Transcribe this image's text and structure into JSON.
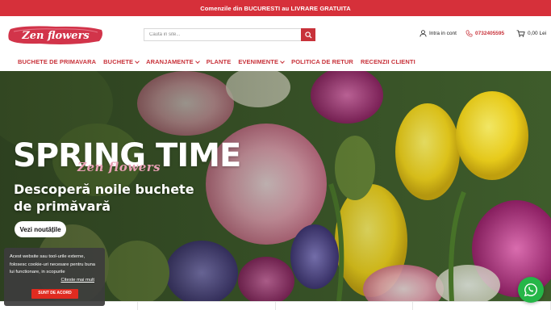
{
  "topbar": {
    "text": "Comenzile din BUCURESTI au LIVRARE GRATUITA"
  },
  "header": {
    "logo_text": "Zen flowers",
    "search": {
      "placeholder": "Cauta in site..."
    },
    "account_label": "Intra in cont",
    "phone": "0732405595",
    "cart_total": "0,00 Lei"
  },
  "nav": {
    "items": [
      {
        "label": "BUCHETE DE PRIMAVARA",
        "has_dropdown": false
      },
      {
        "label": "BUCHETE",
        "has_dropdown": true
      },
      {
        "label": "ARANJAMENTE",
        "has_dropdown": true
      },
      {
        "label": "PLANTE",
        "has_dropdown": false
      },
      {
        "label": "EVENIMENTE",
        "has_dropdown": true
      },
      {
        "label": "POLITICA DE RETUR",
        "has_dropdown": false
      },
      {
        "label": "RECENZII CLIENTI",
        "has_dropdown": false
      }
    ]
  },
  "hero": {
    "title": "SPRING TIME",
    "script": "Zen flowers",
    "subtitle_line1": "Descoperă noile buchete",
    "subtitle_line2": "de primăvară",
    "cta": "Vezi noutățile"
  },
  "cookie": {
    "text": "Acest website sau tool-urile externe, folosesc cookie-uri necesare pentru buna lui functionare, in scopurile",
    "link": "Citeste mai mult",
    "button": "SUNT DE ACORD"
  },
  "colors": {
    "brand": "#c8323a",
    "topbar": "#d6303a",
    "whatsapp": "#25b648"
  },
  "icons": [
    "search-icon",
    "user-icon",
    "phone-icon",
    "cart-icon",
    "whatsapp-icon"
  ]
}
